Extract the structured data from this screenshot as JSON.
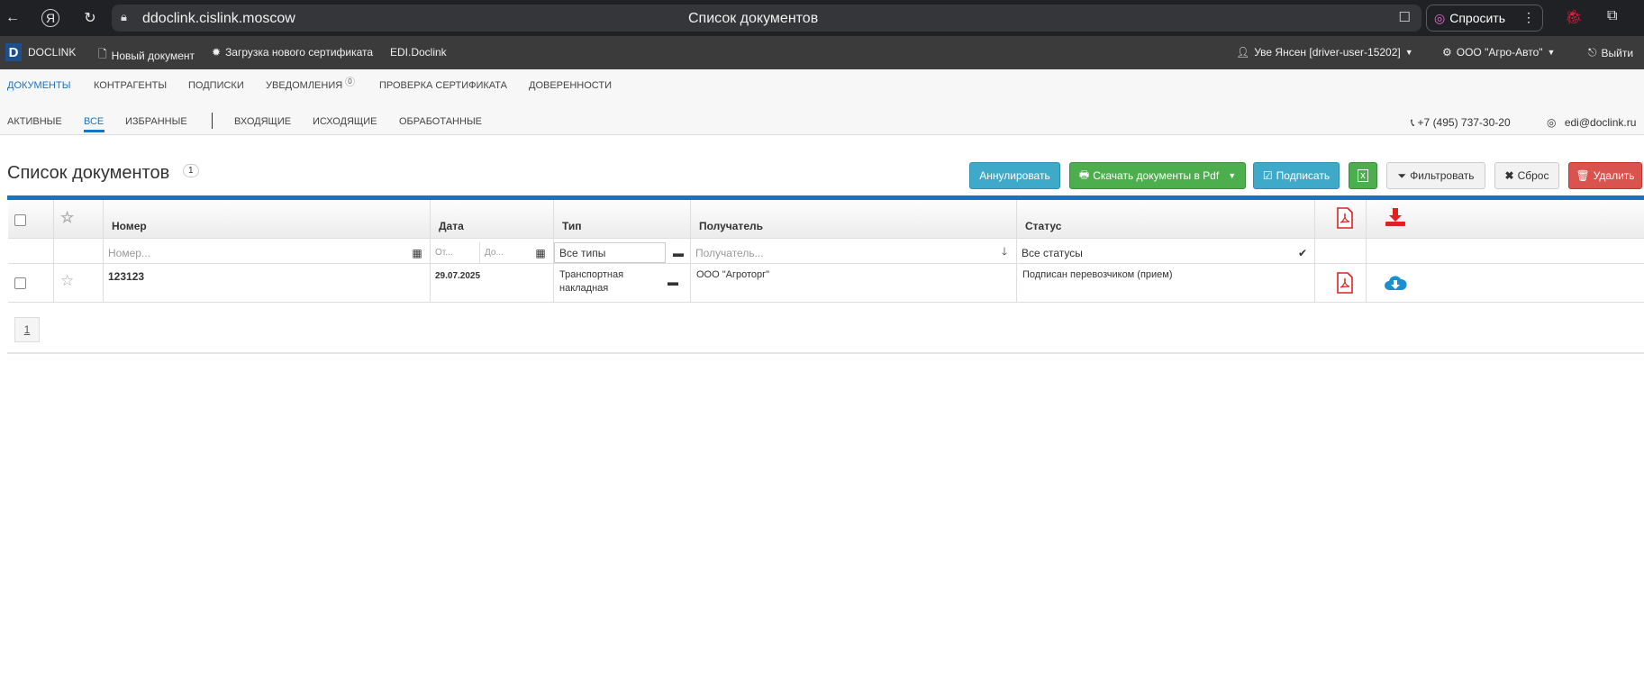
{
  "browser": {
    "url": "ddoclink.cislink.moscow",
    "tab_title": "Список документов",
    "ask_label": "Спросить"
  },
  "topnav": {
    "logo_letter": "D",
    "logo_text": "DOCLINK",
    "new_doc": "Новый документ",
    "upload_cert": "Загрузка нового сертификата",
    "edi": "EDI.Doclink",
    "user": "Уве Янсен [driver-user-15202]",
    "org": "ООО \"Агро-Авто\"",
    "logout": "Выйти"
  },
  "mainnav": {
    "items": [
      "ДОКУМЕНТЫ",
      "КОНТРАГЕНТЫ",
      "ПОДПИСКИ",
      "УВЕДОМЛЕНИЯ",
      "ПРОВЕРКА СЕРТИФИКАТА",
      "ДОВЕРЕННОСТИ"
    ],
    "notifications_count": "0"
  },
  "subnav": {
    "items": [
      "АКТИВНЫЕ",
      "ВСЕ",
      "ИЗБРАННЫЕ",
      "ВХОДЯЩИЕ",
      "ИСХОДЯЩИЕ",
      "ОБРАБОТАННЫЕ"
    ],
    "phone": "+7 (495) 737-30-20",
    "email": "edi@doclink.ru"
  },
  "page": {
    "title": "Список документов",
    "count": "1"
  },
  "actions": {
    "annul": "Аннулировать",
    "download_pdf": "Скачать документы в Pdf",
    "sign": "Подписать",
    "filter": "Фильтровать",
    "reset": "Сброс",
    "delete": "Удалить"
  },
  "table": {
    "headers": {
      "number": "Номер",
      "date": "Дата",
      "type": "Тип",
      "recipient": "Получатель",
      "status": "Статус"
    },
    "filters": {
      "number_placeholder": "Номер...",
      "date_from": "От...",
      "date_to": "До...",
      "type_value": "Все типы",
      "recipient_placeholder": "Получатель...",
      "status_value": "Все статусы"
    },
    "rows": [
      {
        "number": "123123",
        "date": "29.07.2025",
        "type_line1": "Транспортная",
        "type_line2": "накладная",
        "recipient": "ООО \"Агроторг\"",
        "status": "Подписан перевозчиком (прием)"
      }
    ]
  },
  "pagination": {
    "current": "1"
  }
}
